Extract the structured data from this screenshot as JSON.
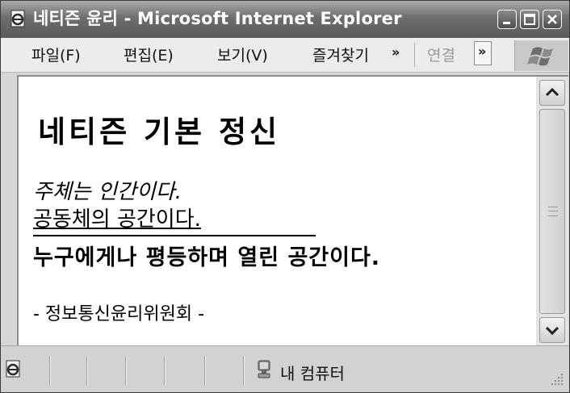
{
  "window": {
    "title": "네티즌 윤리 - Microsoft Internet Explorer"
  },
  "menu": {
    "items": [
      "파일(F)",
      "편집(E)",
      "보기(V)",
      "즐겨찾기"
    ],
    "overflow_glyph": "»",
    "links_label": "연결"
  },
  "page": {
    "heading": "네티즌 기본 정신",
    "line1": "주체는 인간이다.",
    "line2": "공동체의 공간이다.",
    "line3": "누구에게나 평등하며 열린 공간이다.",
    "signature": "- 정보통신윤리위원회 -"
  },
  "status": {
    "zone": "내 컴퓨터"
  },
  "icons": {
    "app": "ie-page-icon",
    "minimize": "minimize-icon",
    "maximize": "maximize-icon",
    "close": "close-icon",
    "brand": "windows-flag-icon",
    "scroll_up": "chevron-up-icon",
    "scroll_down": "chevron-down-icon",
    "status_page": "ie-page-icon",
    "zone": "computer-icon"
  }
}
